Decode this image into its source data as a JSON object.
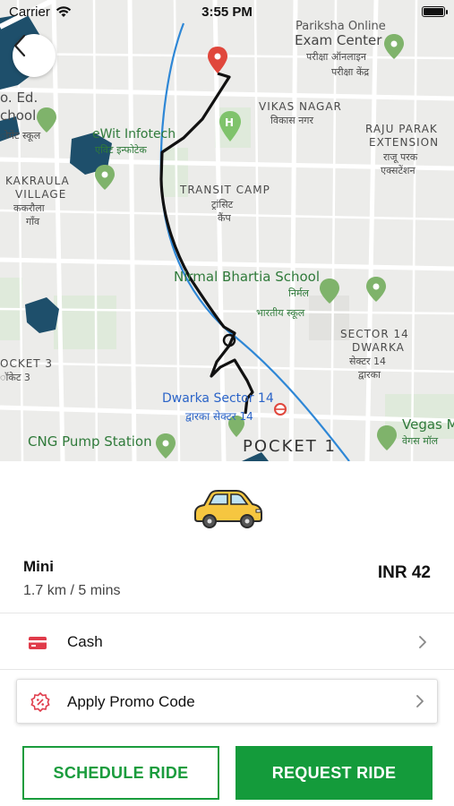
{
  "status_bar": {
    "carrier": "Carrier",
    "time": "3:55 PM"
  },
  "map": {
    "labels": {
      "exam_center_1": "Pariksha Online",
      "exam_center_2": "Exam Center",
      "exam_center_hi": "परीक्षा ऑनलाइन",
      "exam_center_hi2": "परीक्षा केंद्र",
      "school_left_1": "o. Ed.",
      "school_left_2": "chool",
      "school_left_hi": "ोमेंट स्कूल",
      "vikas_nagar": "VIKAS NAGAR",
      "vikas_nagar_hi": "विकास नगर",
      "raju_park_1": "RAJU PARAK",
      "raju_park_2": "EXTENSION",
      "raju_park_hi1": "राजू परक",
      "raju_park_hi2": "एक्सटेंशन",
      "ewit": "eWit Infotech",
      "ewit_hi": "एविट इन्फोटेक",
      "kakraula_1": "KAKRAULA",
      "kakraula_2": "VILLAGE",
      "kakraula_hi1": "ककरौला",
      "kakraula_hi2": "गाँव",
      "transit_camp": "TRANSIT CAMP",
      "transit_camp_hi1": "ट्रांसिट",
      "transit_camp_hi2": "कैंप",
      "nirmal": "Nirmal Bhartia School",
      "nirmal_hi1": "निर्मल",
      "nirmal_hi2": "भारतीय स्कूल",
      "sector14_1": "SECTOR 14",
      "sector14_2": "DWARKA",
      "sector14_hi1": "सेक्टर 14",
      "sector14_hi2": "द्वारका",
      "pocket3": "OCKET 3",
      "pocket3_hi": "ॉकेट 3",
      "dwarka_metro": "Dwarka Sector 14",
      "dwarka_metro_hi": "द्वारका सेक्टर 14",
      "cng": "CNG Pump Station",
      "pocket1": "POCKET 1",
      "vegas": "Vegas M",
      "vegas_hi": "वेगस मॉल"
    }
  },
  "ride": {
    "name": "Mini",
    "distance_time": "1.7 km / 5 mins",
    "fare": "INR 42"
  },
  "payment": {
    "label": "Cash",
    "icon": "card-icon"
  },
  "promo": {
    "label": "Apply Promo Code",
    "icon": "discount-badge-icon"
  },
  "actions": {
    "schedule_label": "SCHEDULE RIDE",
    "request_label": "REQUEST RIDE"
  },
  "colors": {
    "brand_green": "#149b3b",
    "route": "#111111",
    "pin_red": "#e0473c",
    "map_bg": "#ededea"
  }
}
